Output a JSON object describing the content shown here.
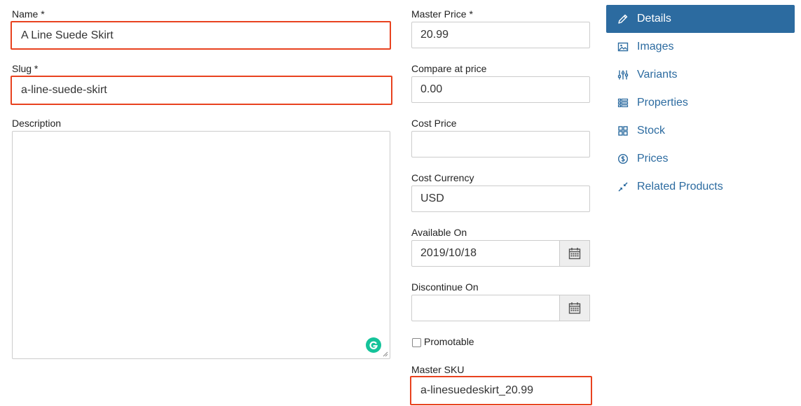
{
  "form": {
    "name": {
      "label": "Name *",
      "value": "A Line Suede Skirt"
    },
    "slug": {
      "label": "Slug *",
      "value": "a-line-suede-skirt"
    },
    "description": {
      "label": "Description",
      "value": ""
    },
    "master_price": {
      "label": "Master Price *",
      "value": "20.99"
    },
    "compare_at_price": {
      "label": "Compare at price",
      "value": "0.00"
    },
    "cost_price": {
      "label": "Cost Price",
      "value": ""
    },
    "cost_currency": {
      "label": "Cost Currency",
      "value": "USD"
    },
    "available_on": {
      "label": "Available On",
      "value": "2019/10/18"
    },
    "discontinue_on": {
      "label": "Discontinue On",
      "value": ""
    },
    "promotable": {
      "label": "Promotable",
      "checked": false
    },
    "master_sku": {
      "label": "Master SKU",
      "value": "a-linesuedeskirt_20.99"
    }
  },
  "sidebar": {
    "items": [
      {
        "label": "Details",
        "icon": "pencil-icon",
        "active": true
      },
      {
        "label": "Images",
        "icon": "image-icon",
        "active": false
      },
      {
        "label": "Variants",
        "icon": "sliders-icon",
        "active": false
      },
      {
        "label": "Properties",
        "icon": "list-icon",
        "active": false
      },
      {
        "label": "Stock",
        "icon": "grid-icon",
        "active": false
      },
      {
        "label": "Prices",
        "icon": "dollar-circle-icon",
        "active": false
      },
      {
        "label": "Related Products",
        "icon": "arrows-in-icon",
        "active": false
      }
    ]
  },
  "colors": {
    "accent": "#2c6ba0",
    "highlight": "#e8421f",
    "grammarly": "#15c39a"
  }
}
